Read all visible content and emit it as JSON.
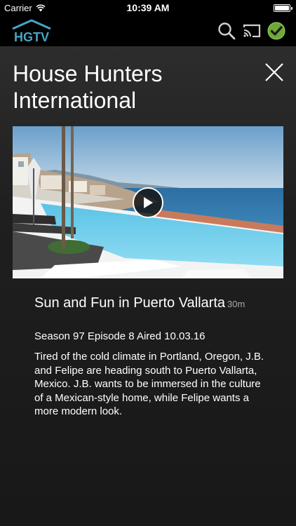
{
  "status_bar": {
    "carrier": "Carrier",
    "time": "10:39 AM",
    "wifi_icon": "wifi-icon",
    "battery_icon": "battery-icon"
  },
  "header": {
    "logo_text": "HGTV",
    "icons": [
      "search-icon",
      "cast-icon",
      "check-circle-icon"
    ],
    "accent_color": "#6fa83a"
  },
  "show": {
    "title": "House Hunters International"
  },
  "episode": {
    "title": "Sun and Fun in Puerto Vallarta",
    "duration": "30m",
    "meta": "Season 97 Episode 8 Aired 10.03.16",
    "description": "Tired of the cold climate in Portland, Oregon, J.B. and Felipe are heading south to Puerto Vallarta, Mexico. J.B. wants to be immersed in the culture of a Mexican-style home, while Felipe wants a more modern look."
  },
  "video": {
    "play_icon": "play-icon"
  }
}
